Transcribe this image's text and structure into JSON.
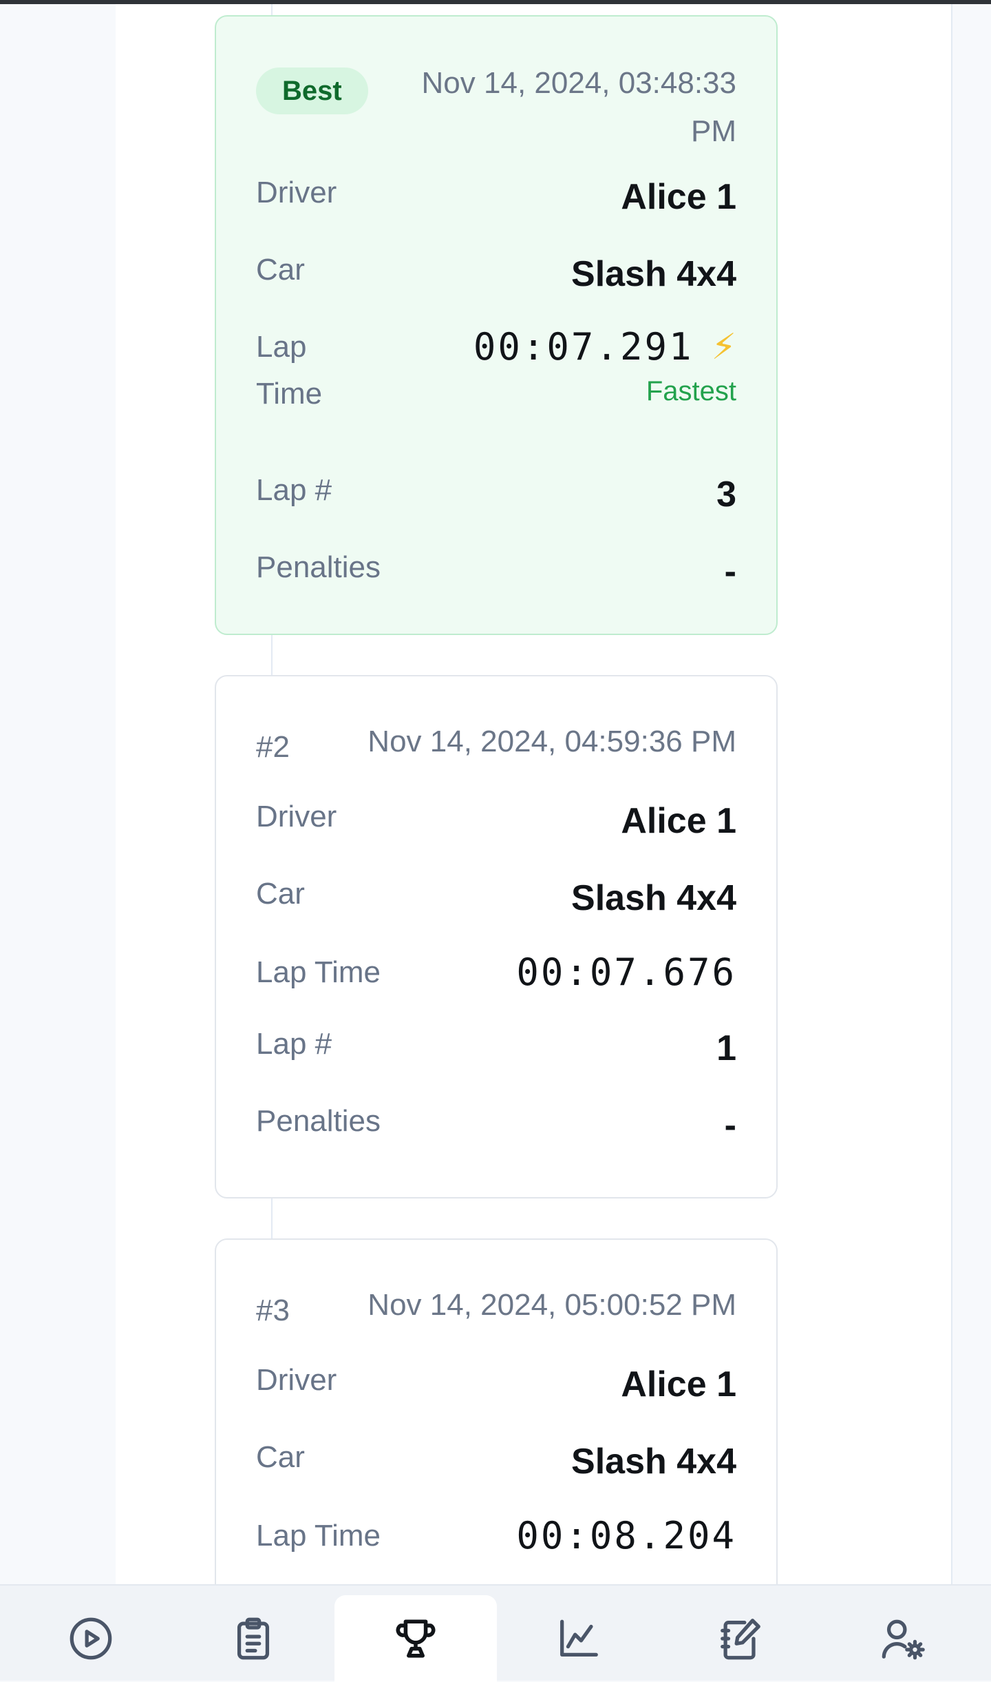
{
  "cards": [
    {
      "badge": "Best",
      "date": "Nov 14, 2024, 03:48:33 PM",
      "driver_label": "Driver",
      "driver": "Alice 1",
      "car_label": "Car",
      "car": "Slash 4x4",
      "lap_time_label": "Lap Time",
      "lap_time": "00:07.291",
      "fastest_label": "Fastest",
      "lap_num_label": "Lap #",
      "lap_num": "3",
      "penalties_label": "Penalties",
      "penalties": "-"
    },
    {
      "rank": "#2",
      "date": "Nov 14, 2024, 04:59:36 PM",
      "driver_label": "Driver",
      "driver": "Alice 1",
      "car_label": "Car",
      "car": "Slash 4x4",
      "lap_time_label": "Lap Time",
      "lap_time": "00:07.676",
      "lap_num_label": "Lap #",
      "lap_num": "1",
      "penalties_label": "Penalties",
      "penalties": "-"
    },
    {
      "rank": "#3",
      "date": "Nov 14, 2024, 05:00:52 PM",
      "driver_label": "Driver",
      "driver": "Alice 1",
      "car_label": "Car",
      "car": "Slash 4x4",
      "lap_time_label": "Lap Time",
      "lap_time": "00:08.204"
    }
  ],
  "nav": {
    "items": [
      {
        "icon": "play-circle-icon"
      },
      {
        "icon": "clipboard-icon"
      },
      {
        "icon": "trophy-icon",
        "active": true
      },
      {
        "icon": "chart-icon"
      },
      {
        "icon": "notebook-edit-icon"
      },
      {
        "icon": "user-settings-icon"
      }
    ]
  },
  "colors": {
    "best_bg": "#effbf3",
    "best_border": "#bfeccf",
    "badge_text": "#0f6a2c",
    "fastest": "#23a24d",
    "bolt": "#f5c232"
  }
}
